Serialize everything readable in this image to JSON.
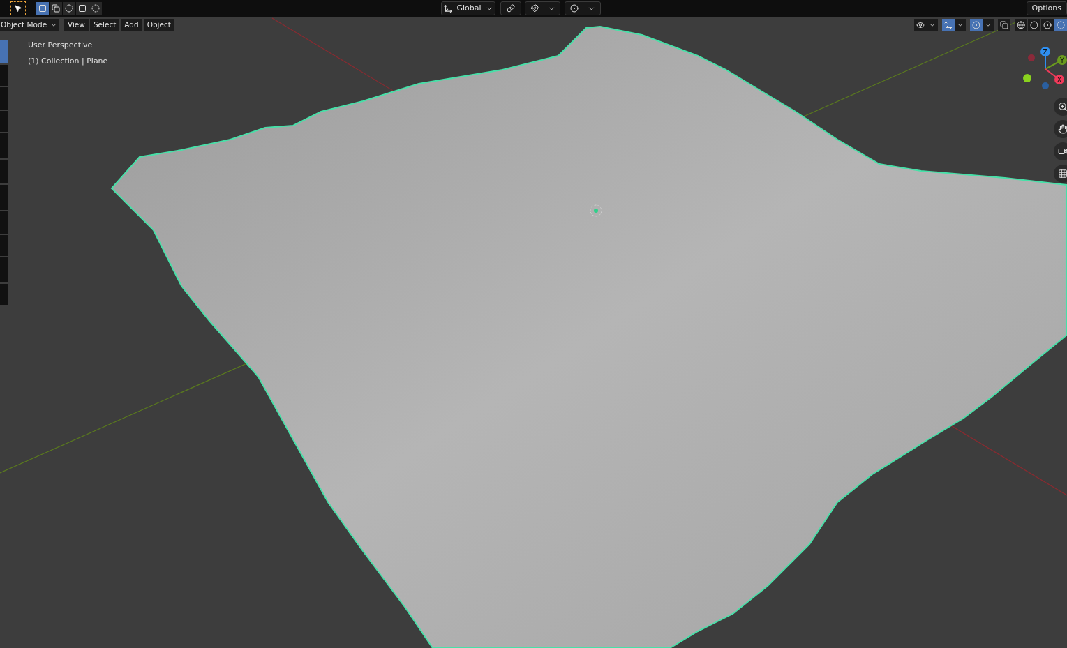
{
  "top_bar": {
    "select_tool": {
      "selected": true
    },
    "select_modes": [
      {
        "kind": "new",
        "selected": true
      },
      {
        "kind": "extend",
        "selected": false
      },
      {
        "kind": "subtract",
        "selected": false
      },
      {
        "kind": "invert",
        "selected": false
      },
      {
        "kind": "intersect",
        "selected": false
      }
    ],
    "orientation": "Global",
    "snap": {
      "on": false
    },
    "proportional": {
      "on": false
    },
    "options": "Options"
  },
  "viewport_header": {
    "mode": "Object Mode",
    "menus": [
      "View",
      "Select",
      "Add",
      "Object"
    ],
    "toggles": [
      {
        "kind": "visibility",
        "on": false
      },
      {
        "kind": "gizmo",
        "on": true
      },
      {
        "kind": "overlay",
        "on": true
      },
      {
        "kind": "xray",
        "on": false
      }
    ],
    "shading": [
      {
        "kind": "wireframe",
        "selected": false
      },
      {
        "kind": "solid",
        "selected": false
      },
      {
        "kind": "material",
        "selected": false
      },
      {
        "kind": "rendered",
        "selected": true
      }
    ]
  },
  "viewport": {
    "view_name": "User Perspective",
    "object_info": "(1) Collection | Plane",
    "gizmo_axes": [
      "Z",
      "Y",
      "X"
    ]
  },
  "toolbar": [
    {
      "selected": true
    },
    {
      "selected": false
    },
    {
      "selected": false
    },
    {
      "selected": false
    },
    {
      "selected": false
    },
    {
      "selected": false
    },
    {
      "selected": false
    },
    {
      "selected": false
    },
    {
      "selected": false
    },
    {
      "selected": false
    },
    {
      "selected": false
    }
  ]
}
